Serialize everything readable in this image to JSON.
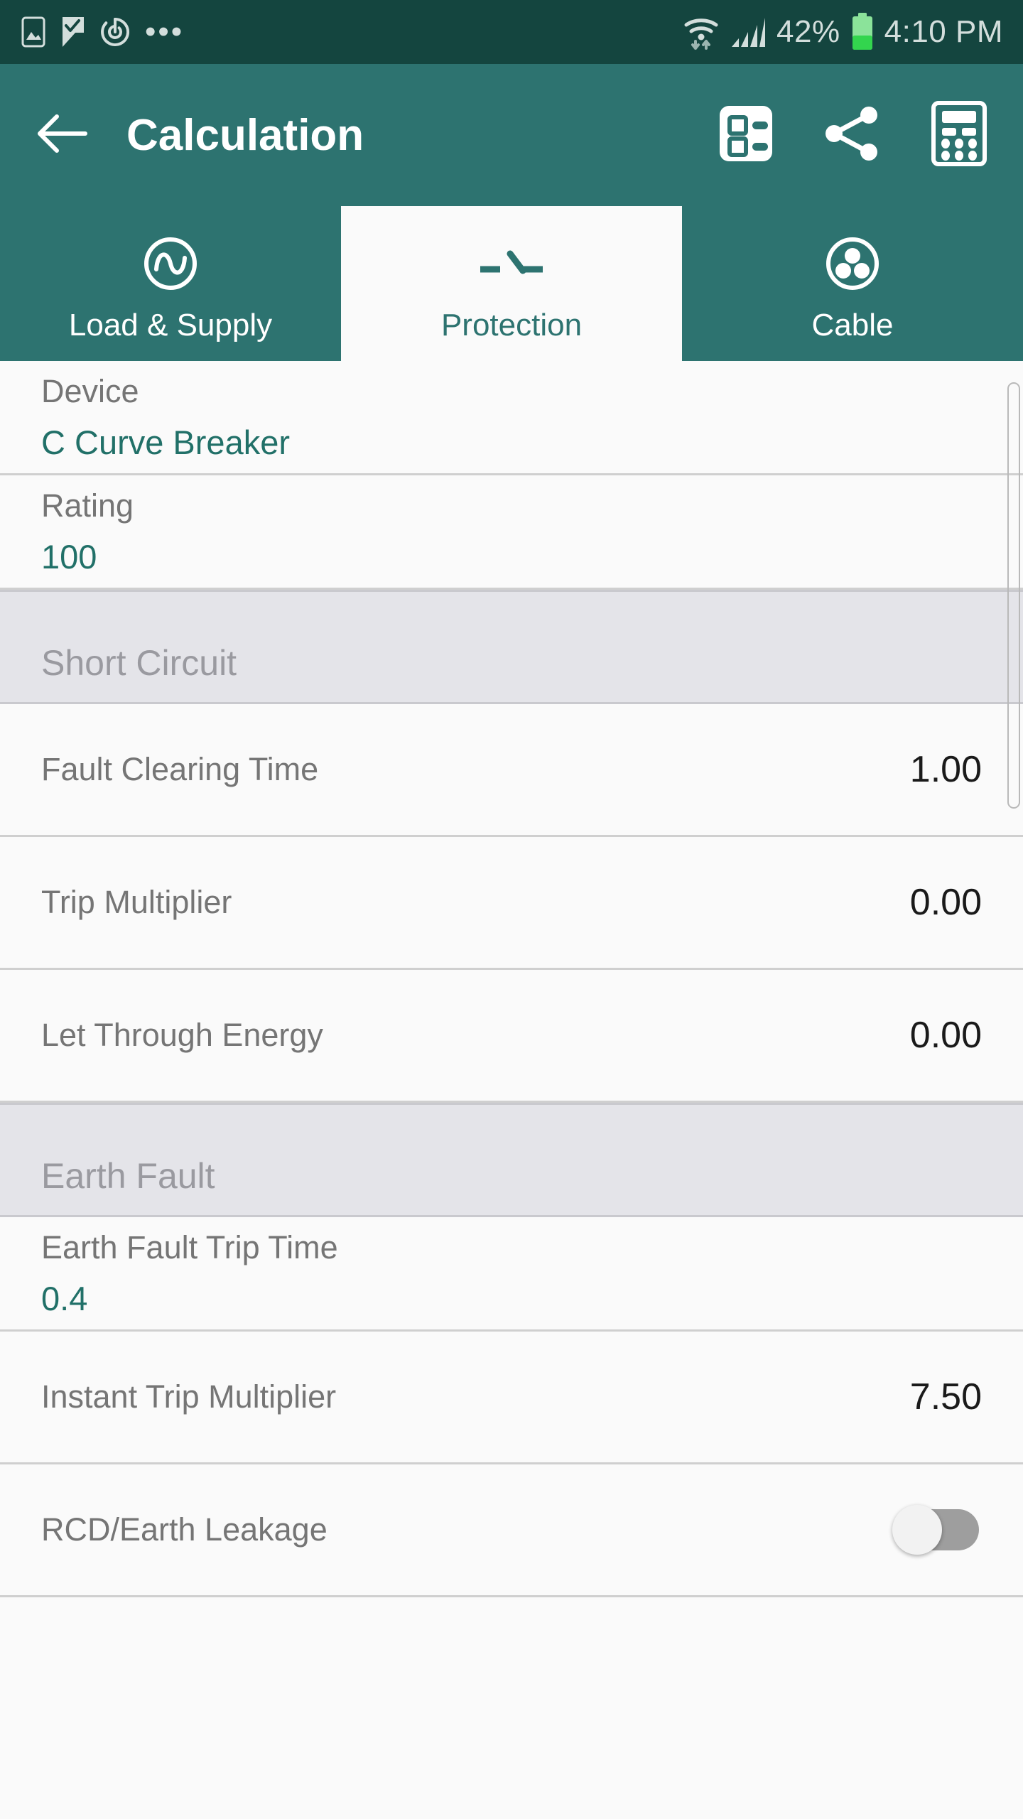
{
  "status_bar": {
    "left_icons": [
      "image-icon",
      "check-flag-icon",
      "sync-icon",
      "more-dots-icon"
    ],
    "wifi_icon": "wifi-icon",
    "signal_icon": "signal-bars-icon",
    "battery_percent": "42%",
    "battery_icon": "battery-icon",
    "battery_level": 42,
    "time": "4:10 PM",
    "background": "#14453F",
    "text_color": "#D3DEDC",
    "battery_color": "#33D54E"
  },
  "app_bar": {
    "back_icon": "back-arrow-icon",
    "title": "Calculation",
    "actions": [
      {
        "name": "summary-icon",
        "label": "Summary"
      },
      {
        "name": "share-icon",
        "label": "Share"
      },
      {
        "name": "calculator-icon",
        "label": "Calculator"
      }
    ],
    "background": "#2D7370",
    "title_color": "#FFFFFF"
  },
  "tabs": {
    "selected_index": 1,
    "items": [
      {
        "label": "Load & Supply",
        "icon": "ac-source-icon"
      },
      {
        "label": "Protection",
        "icon": "circuit-breaker-icon"
      },
      {
        "label": "Cable",
        "icon": "cable-core-icon"
      }
    ],
    "selected_bg": "#FAFAFA",
    "selected_color": "#2D7370",
    "unselected_color": "#FFFFFF"
  },
  "content": {
    "rows": [
      {
        "type": "stacked",
        "label": "Device",
        "value": "C Curve Breaker"
      },
      {
        "type": "stacked",
        "label": "Rating",
        "value": "100"
      },
      {
        "type": "section",
        "label": "Short Circuit"
      },
      {
        "type": "inline",
        "label": "Fault Clearing Time",
        "value": "1.00"
      },
      {
        "type": "inline",
        "label": "Trip Multiplier",
        "value": "0.00"
      },
      {
        "type": "inline",
        "label": "Let Through Energy",
        "value": "0.00"
      },
      {
        "type": "section",
        "label": "Earth Fault"
      },
      {
        "type": "stacked",
        "label": "Earth Fault Trip Time",
        "value": "0.4"
      },
      {
        "type": "inline",
        "label": "Instant Trip Multiplier",
        "value": "7.50"
      },
      {
        "type": "toggle",
        "label": "RCD/Earth Leakage",
        "value": "off"
      }
    ],
    "value_teal": "#217068",
    "value_dark": "#1A1A1A",
    "label_color": "#757575",
    "section_bg": "#E4E4E9",
    "section_color": "#9A9AA0",
    "background": "#FAFAFA"
  },
  "scrollbar": {
    "name": "vertical-scrollbar"
  }
}
